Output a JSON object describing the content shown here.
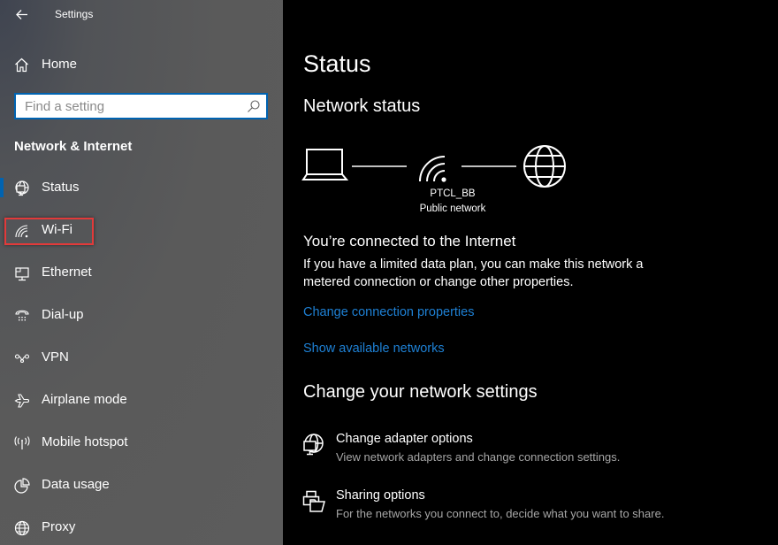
{
  "window": {
    "title": "Settings"
  },
  "sidebar": {
    "home_label": "Home",
    "search": {
      "placeholder": "Find a setting",
      "value": ""
    },
    "section_title": "Network & Internet",
    "items": [
      {
        "id": "status",
        "label": "Status",
        "icon": "network-status-icon",
        "selected": true
      },
      {
        "id": "wifi",
        "label": "Wi-Fi",
        "icon": "wifi-icon",
        "selected": false,
        "highlighted": true
      },
      {
        "id": "ethernet",
        "label": "Ethernet",
        "icon": "ethernet-icon",
        "selected": false
      },
      {
        "id": "dialup",
        "label": "Dial-up",
        "icon": "phone-icon",
        "selected": false
      },
      {
        "id": "vpn",
        "label": "VPN",
        "icon": "vpn-icon",
        "selected": false
      },
      {
        "id": "airplane",
        "label": "Airplane mode",
        "icon": "airplane-icon",
        "selected": false
      },
      {
        "id": "hotspot",
        "label": "Mobile hotspot",
        "icon": "hotspot-icon",
        "selected": false
      },
      {
        "id": "datausage",
        "label": "Data usage",
        "icon": "pie-chart-icon",
        "selected": false
      },
      {
        "id": "proxy",
        "label": "Proxy",
        "icon": "globe-icon",
        "selected": false
      }
    ]
  },
  "main": {
    "title": "Status",
    "network_status_heading": "Network status",
    "network": {
      "name": "PTCL_BB",
      "type": "Public network"
    },
    "connection_title": "You’re connected to the Internet",
    "connection_desc": "If you have a limited data plan, you can make this network a metered connection or change other properties.",
    "links": {
      "change_connection": "Change connection properties",
      "show_networks": "Show available networks"
    },
    "change_settings_heading": "Change your network settings",
    "options": [
      {
        "title": "Change adapter options",
        "desc": "View network adapters and change connection settings.",
        "icon": "adapter-icon"
      },
      {
        "title": "Sharing options",
        "desc": "For the networks you connect to, decide what you want to share.",
        "icon": "sharing-icon"
      }
    ]
  },
  "colors": {
    "accent": "#0063b1",
    "link": "#1e80d4",
    "highlight_border": "#e23a3a",
    "sidebar_bg": "#5a5a5a",
    "content_bg": "#000000"
  }
}
